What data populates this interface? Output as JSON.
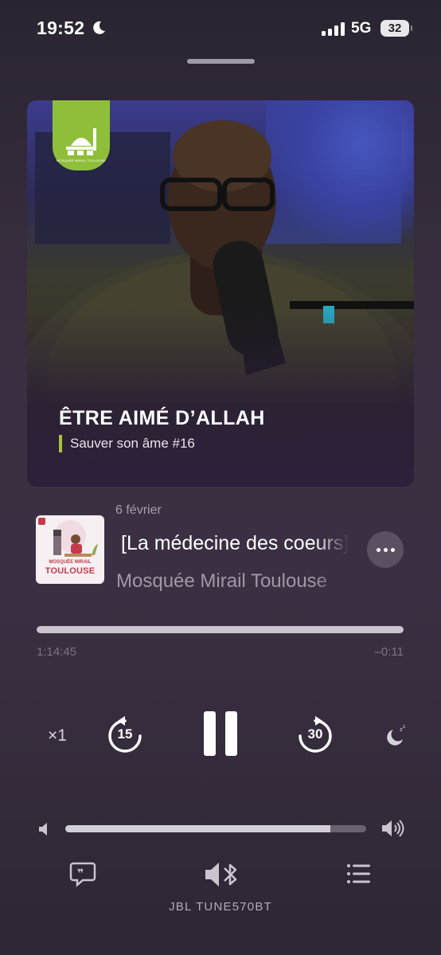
{
  "status_bar": {
    "time": "19:52",
    "network": "5G",
    "battery": "32"
  },
  "artwork": {
    "title": "ÊTRE AIMÉ D’ALLAH",
    "subtitle": "Sauver son âme #16",
    "logo_text": "MOSQUÉE MIRAIL TOULOUSE",
    "accent": "#a6c33c"
  },
  "episode": {
    "date": "6 février",
    "title": "[La médecine des coeurs]",
    "author": "Mosquée Mirail Toulouse",
    "thumb_line1": "MOSQUÉE MIRAIL",
    "thumb_line2": "TOULOUSE"
  },
  "playback": {
    "elapsed": "1:14:45",
    "remaining": "–0:11",
    "progress": 0.9998,
    "speed": "×1",
    "skip_back": "15",
    "skip_forward": "30"
  },
  "volume": {
    "level": 0.88
  },
  "output": {
    "device": "JBL TUNE570BT"
  }
}
